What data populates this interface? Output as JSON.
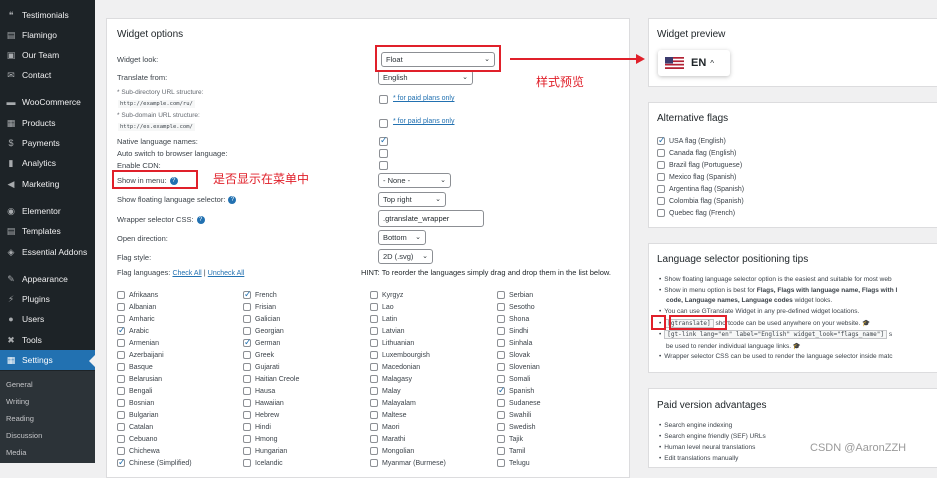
{
  "sidebar": {
    "items": [
      {
        "icon": "quote-icon",
        "glyph": "❝",
        "label": "Testimonials"
      },
      {
        "icon": "flamingo-icon",
        "glyph": "▤",
        "label": "Flamingo"
      },
      {
        "icon": "team-icon",
        "glyph": "▣",
        "label": "Our Team"
      },
      {
        "icon": "mail-icon",
        "glyph": "✉",
        "label": "Contact"
      },
      {
        "icon": "woo-icon",
        "glyph": "▬",
        "label": "WooCommerce"
      },
      {
        "icon": "products-icon",
        "glyph": "▦",
        "label": "Products"
      },
      {
        "icon": "payments-icon",
        "glyph": "$",
        "label": "Payments"
      },
      {
        "icon": "analytics-icon",
        "glyph": "▮",
        "label": "Analytics"
      },
      {
        "icon": "marketing-icon",
        "glyph": "◀",
        "label": "Marketing"
      },
      {
        "icon": "elementor-icon",
        "glyph": "◉",
        "label": "Elementor"
      },
      {
        "icon": "templates-icon",
        "glyph": "▤",
        "label": "Templates"
      },
      {
        "icon": "addons-icon",
        "glyph": "◈",
        "label": "Essential Addons"
      },
      {
        "icon": "appearance-icon",
        "glyph": "✎",
        "label": "Appearance"
      },
      {
        "icon": "plugins-icon",
        "glyph": "⚡",
        "label": "Plugins"
      },
      {
        "icon": "users-icon",
        "glyph": "●",
        "label": "Users"
      },
      {
        "icon": "tools-icon",
        "glyph": "✖",
        "label": "Tools"
      },
      {
        "icon": "settings-icon",
        "glyph": "▦",
        "label": "Settings"
      }
    ],
    "submenu": [
      "General",
      "Writing",
      "Reading",
      "Discussion",
      "Media"
    ]
  },
  "widget_options": {
    "title": "Widget options",
    "widget_look_label": "Widget look:",
    "widget_look_value": "Float",
    "translate_from_label": "Translate from:",
    "translate_from_value": "English",
    "subdir_label": "* Sub-directory URL structure:",
    "subdir_example": "http://example.com/ru/",
    "subdomain_label": "* Sub-domain URL structure:",
    "subdomain_example": "http://es.example.com/",
    "paid_link": "* for paid plans only",
    "native_names_label": "Native language names:",
    "auto_switch_label": "Auto switch to browser language:",
    "enable_cdn_label": "Enable CDN:",
    "show_in_menu_label": "Show in menu:",
    "show_in_menu_value": "- None -",
    "floating_selector_label": "Show floating language selector:",
    "floating_selector_value": "Top right",
    "wrapper_css_label": "Wrapper selector CSS:",
    "wrapper_css_value": ".gtranslate_wrapper",
    "open_direction_label": "Open direction:",
    "open_direction_value": "Bottom",
    "flag_style_label": "Flag style:",
    "flag_style_value": "2D (.svg)",
    "flag_languages_label": "Flag languages:",
    "check_all": "Check All",
    "uncheck_all": "Uncheck All",
    "hint": "HINT: To reorder the languages simply drag and drop them in the list below."
  },
  "languages": {
    "col1": [
      [
        "Afrikaans",
        false
      ],
      [
        "Albanian",
        false
      ],
      [
        "Amharic",
        false
      ],
      [
        "Arabic",
        true
      ],
      [
        "Armenian",
        false
      ],
      [
        "Azerbaijani",
        false
      ],
      [
        "Basque",
        false
      ],
      [
        "Belarusian",
        false
      ],
      [
        "Bengali",
        false
      ],
      [
        "Bosnian",
        false
      ],
      [
        "Bulgarian",
        false
      ],
      [
        "Catalan",
        false
      ],
      [
        "Cebuano",
        false
      ],
      [
        "Chichewa",
        false
      ],
      [
        "Chinese (Simplified)",
        true
      ]
    ],
    "col2": [
      [
        "French",
        true
      ],
      [
        "Frisian",
        false
      ],
      [
        "Galician",
        false
      ],
      [
        "Georgian",
        false
      ],
      [
        "German",
        true
      ],
      [
        "Greek",
        false
      ],
      [
        "Gujarati",
        false
      ],
      [
        "Haitian Creole",
        false
      ],
      [
        "Hausa",
        false
      ],
      [
        "Hawaiian",
        false
      ],
      [
        "Hebrew",
        false
      ],
      [
        "Hindi",
        false
      ],
      [
        "Hmong",
        false
      ],
      [
        "Hungarian",
        false
      ],
      [
        "Icelandic",
        false
      ]
    ],
    "col3": [
      [
        "Kyrgyz",
        false
      ],
      [
        "Lao",
        false
      ],
      [
        "Latin",
        false
      ],
      [
        "Latvian",
        false
      ],
      [
        "Lithuanian",
        false
      ],
      [
        "Luxembourgish",
        false
      ],
      [
        "Macedonian",
        false
      ],
      [
        "Malagasy",
        false
      ],
      [
        "Malay",
        false
      ],
      [
        "Malayalam",
        false
      ],
      [
        "Maltese",
        false
      ],
      [
        "Maori",
        false
      ],
      [
        "Marathi",
        false
      ],
      [
        "Mongolian",
        false
      ],
      [
        "Myanmar (Burmese)",
        false
      ]
    ],
    "col4": [
      [
        "Serbian",
        false
      ],
      [
        "Sesotho",
        false
      ],
      [
        "Shona",
        false
      ],
      [
        "Sindhi",
        false
      ],
      [
        "Sinhala",
        false
      ],
      [
        "Slovak",
        false
      ],
      [
        "Slovenian",
        false
      ],
      [
        "Somali",
        false
      ],
      [
        "Spanish",
        true
      ],
      [
        "Sudanese",
        false
      ],
      [
        "Swahili",
        false
      ],
      [
        "Swedish",
        false
      ],
      [
        "Tajik",
        false
      ],
      [
        "Tamil",
        false
      ],
      [
        "Telugu",
        false
      ]
    ]
  },
  "preview": {
    "title": "Widget preview",
    "lang_code": "EN",
    "chevron": "^"
  },
  "alt_flags": {
    "title": "Alternative flags",
    "items": [
      [
        "USA flag (English)",
        true
      ],
      [
        "Canada flag (English)",
        false
      ],
      [
        "Brazil flag (Portuguese)",
        false
      ],
      [
        "Mexico flag (Spanish)",
        false
      ],
      [
        "Argentina flag (Spanish)",
        false
      ],
      [
        "Colombia flag (Spanish)",
        false
      ],
      [
        "Quebec flag (French)",
        false
      ]
    ]
  },
  "tips": {
    "title": "Language selector positioning tips",
    "line1": "Show floating language selector option is the easiest and suitable for most web",
    "line2": "Show in menu option is best for ",
    "line2_bold": "Flags, Flags with language name, Flags with l",
    "line3_bold": "code, Language names, Language codes",
    "line3": " widget looks.",
    "line4": "You can use GTranslate Widget in any pre-defined widget locations.",
    "shortcode": "[gtranslate]",
    "line5": " shortcode can be used anywhere on your website.",
    "gtlink": "[gt-link lang=\"en\" label=\"English\" widget_look=\"flags_name\"]",
    "line6_tail": " s",
    "line7": "be used to render individual language links.",
    "line8": "Wrapper selector CSS can be used to render the language selector inside matc"
  },
  "paid": {
    "title": "Paid version advantages",
    "items": [
      "Search engine indexing",
      "Search engine friendly (SEF) URLs",
      "Human level neural translations",
      "Edit translations manually"
    ]
  },
  "annotations": {
    "style_preview": "样式预览",
    "show_in_menu_note": "是否显示在菜单中"
  },
  "watermark": "CSDN @AaronZZH",
  "colors": {
    "annotation_red": "#e0202a",
    "wp_blue": "#2271b1",
    "sidebar_bg": "#1d2327"
  }
}
